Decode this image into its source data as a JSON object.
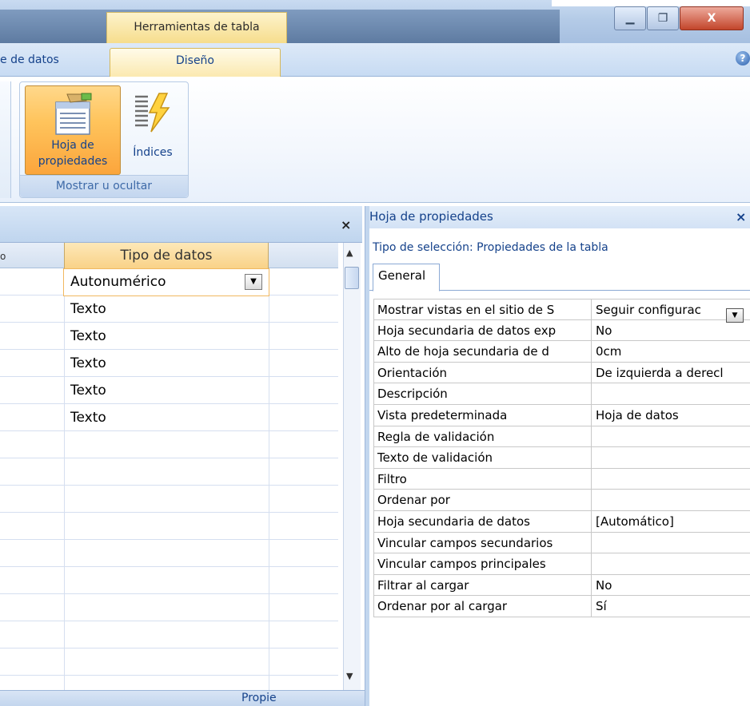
{
  "titlebar": {
    "context_tab": "Herramientas de tabla"
  },
  "ribbon": {
    "tabs": [
      {
        "label": "e de datos"
      },
      {
        "label": "Diseño"
      }
    ],
    "help": "?",
    "group": {
      "label": "Mostrar u ocultar",
      "buttons": [
        {
          "label_line1": "Hoja de",
          "label_line2": "propiedades"
        },
        {
          "label": "Índices"
        }
      ]
    }
  },
  "table_design": {
    "close": "×",
    "first_col_stub": "o",
    "column_header": "Tipo de datos",
    "rows": [
      {
        "tipo": "Autonumérico"
      },
      {
        "tipo": "Texto"
      },
      {
        "tipo": "Texto"
      },
      {
        "tipo": "Texto"
      },
      {
        "tipo": "Texto"
      },
      {
        "tipo": "Texto"
      }
    ],
    "status_text": "Propie"
  },
  "property_sheet": {
    "title": "Hoja de propiedades",
    "close": "×",
    "selection_type": "Tipo de selección:  Propiedades de la tabla",
    "tab": "General",
    "properties": [
      {
        "name": "Mostrar vistas en el sitio de S",
        "value": "Seguir configurac"
      },
      {
        "name": "Hoja secundaria de datos exp",
        "value": "No"
      },
      {
        "name": "Alto de hoja secundaria de d",
        "value": "0cm"
      },
      {
        "name": "Orientación",
        "value": "De izquierda a derecl"
      },
      {
        "name": "Descripción",
        "value": ""
      },
      {
        "name": "Vista predeterminada",
        "value": "Hoja de datos"
      },
      {
        "name": "Regla de validación",
        "value": ""
      },
      {
        "name": "Texto de validación",
        "value": ""
      },
      {
        "name": "Filtro",
        "value": ""
      },
      {
        "name": "Ordenar por",
        "value": ""
      },
      {
        "name": "Hoja secundaria de datos",
        "value": "[Automático]"
      },
      {
        "name": "Vincular campos secundarios",
        "value": ""
      },
      {
        "name": "Vincular campos principales",
        "value": ""
      },
      {
        "name": "Filtrar al cargar",
        "value": "No"
      },
      {
        "name": "Ordenar por al cargar",
        "value": "Sí"
      }
    ]
  },
  "colors": {
    "accent_orange": "#fba53c",
    "ribbon_blue": "#15428b",
    "tab_gold": "#f9d288"
  }
}
